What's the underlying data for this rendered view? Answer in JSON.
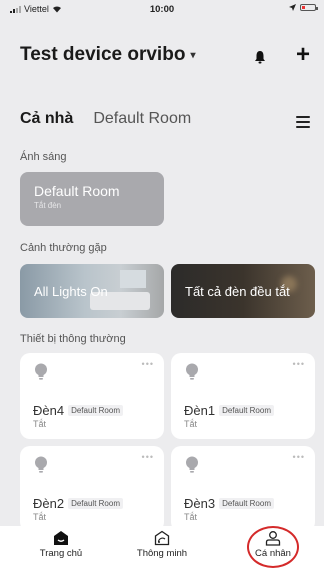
{
  "status_bar": {
    "carrier": "Viettel",
    "time": "10:00"
  },
  "header": {
    "home_name": "Test device orvibo"
  },
  "tabs": {
    "active": "Cả nhà",
    "other": "Default Room"
  },
  "sections": {
    "lighting": "Ánh sáng",
    "scenes": "Cảnh thường gặp",
    "devices": "Thiết bị thông thường"
  },
  "room_card": {
    "name": "Default Room",
    "status": "Tắt đèn"
  },
  "scenes": [
    {
      "label": "All Lights On"
    },
    {
      "label": "Tất cả đèn đều tắt"
    }
  ],
  "devices": [
    {
      "name": "Đèn4",
      "room": "Default Room",
      "state": "Tắt",
      "more": "•••"
    },
    {
      "name": "Đèn1",
      "room": "Default Room",
      "state": "Tắt",
      "more": "•••"
    },
    {
      "name": "Đèn2",
      "room": "Default Room",
      "state": "Tắt",
      "more": "•••"
    },
    {
      "name": "Đèn3",
      "room": "Default Room",
      "state": "Tắt",
      "more": "•••"
    }
  ],
  "bottom_nav": [
    {
      "label": "Trang chủ",
      "icon": "home-icon"
    },
    {
      "label": "Thông minh",
      "icon": "smart-icon"
    },
    {
      "label": "Cá nhân",
      "icon": "profile-icon"
    }
  ],
  "colors": {
    "background": "#ececee",
    "highlight_circle": "#d42a2a",
    "room_card": "#a9a9ad"
  }
}
